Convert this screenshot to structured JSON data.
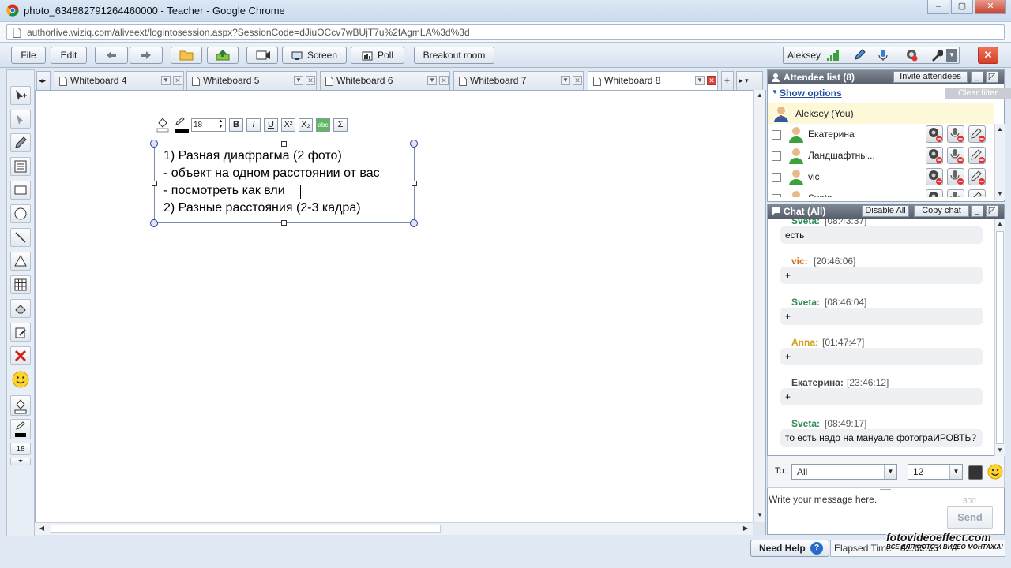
{
  "browser": {
    "title": "photo_634882791264460000 - Teacher - Google Chrome",
    "url": "authorlive.wiziq.com/aliveext/logintosession.aspx?SessionCode=dJiuOCcv7wBUjT7u%2fAgmLA%3d%3d"
  },
  "toolbar": {
    "file": "File",
    "edit": "Edit",
    "screen": "Screen",
    "poll": "Poll",
    "breakout": "Breakout room",
    "user": "Aleksey"
  },
  "tabs": [
    {
      "label": "Whiteboard 4"
    },
    {
      "label": "Whiteboard 5"
    },
    {
      "label": "Whiteboard 6"
    },
    {
      "label": "Whiteboard 7"
    },
    {
      "label": "Whiteboard 8"
    }
  ],
  "editor": {
    "font_size": "18",
    "bold": "B",
    "italic": "I",
    "underline": "U",
    "sum": "Σ",
    "lines": [
      "1) Разная диафрагма (2 фото)",
      "- объект на одном расстоянии от вас",
      "- посмотреть как вли",
      "2) Разные расстояния (2-3 кадра)"
    ]
  },
  "rail": {
    "size": "18"
  },
  "attendees": {
    "title": "Attendee list (8)",
    "invite": "Invite attendees",
    "show_options": "Show options",
    "clear_filter": "Clear filter",
    "self": "Aleksey (You)",
    "list": [
      {
        "name": "Екатерина"
      },
      {
        "name": "Ландшафтны..."
      },
      {
        "name": "vic"
      },
      {
        "name": "Sveta"
      }
    ]
  },
  "chat": {
    "title": "Chat (All)",
    "disable_all": "Disable All",
    "copy_chat": "Copy chat",
    "messages": [
      {
        "who": "Sveta:",
        "time": "[08:43:37]",
        "text": "есть",
        "color": "#2e8b57"
      },
      {
        "who": "vic:",
        "time": "[20:46:06]",
        "text": "+",
        "color": "#d2691e"
      },
      {
        "who": "Sveta:",
        "time": "[08:46:04]",
        "text": "+",
        "color": "#2e8b57"
      },
      {
        "who": "Anna:",
        "time": "[01:47:47]",
        "text": "+",
        "color": "#d4a017"
      },
      {
        "who": "Екатерина:",
        "time": "[23:46:12]",
        "text": "+",
        "color": "#444444"
      },
      {
        "who": "Sveta:",
        "time": "[08:49:17]",
        "text": "то есть надо на мануале фотограИРОВТЬ?",
        "color": "#2e8b57"
      }
    ],
    "to_label": "To:",
    "to_value": "All",
    "size_value": "12",
    "placeholder": "Write your message here.",
    "counter": "300",
    "send": "Send"
  },
  "status": {
    "need_help": "Need Help",
    "elapsed_label": "Elapsed Time",
    "elapsed_value": "02:00:05",
    "watermark": "fotovideoeffect.com",
    "watermark_sub": "ВСЁ ДЛЯ ФОТО И ВИДЕО МОНТАЖА!"
  },
  "colors": {
    "accent": "#3a7bd5",
    "close_red": "#d93d22"
  }
}
